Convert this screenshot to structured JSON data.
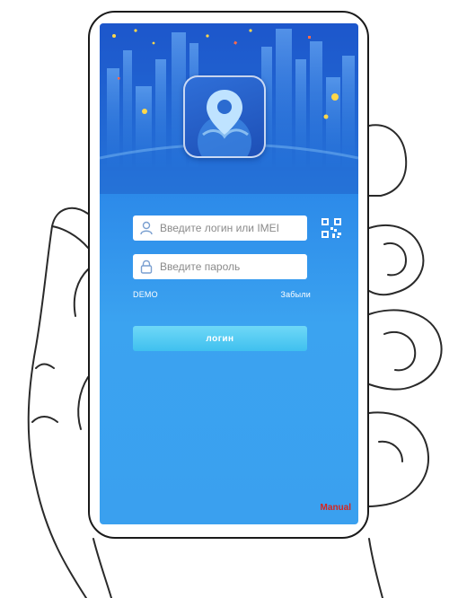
{
  "login": {
    "username_placeholder": "Введите логин или IMEI",
    "password_placeholder": "Введите пароль",
    "demo_label": "DEMO",
    "forgot_label": "Забыли",
    "login_button_label": "логин",
    "manual_label": "Manual"
  },
  "icons": {
    "app_logo": "map-pin-globe-icon",
    "user": "user-icon",
    "lock": "lock-icon",
    "qr": "qr-code-icon"
  },
  "colors": {
    "screen_top": "#1f5fd6",
    "screen_bottom": "#3aa0ef",
    "login_button": "#4fc8f2",
    "manual_text": "#d8231c"
  }
}
